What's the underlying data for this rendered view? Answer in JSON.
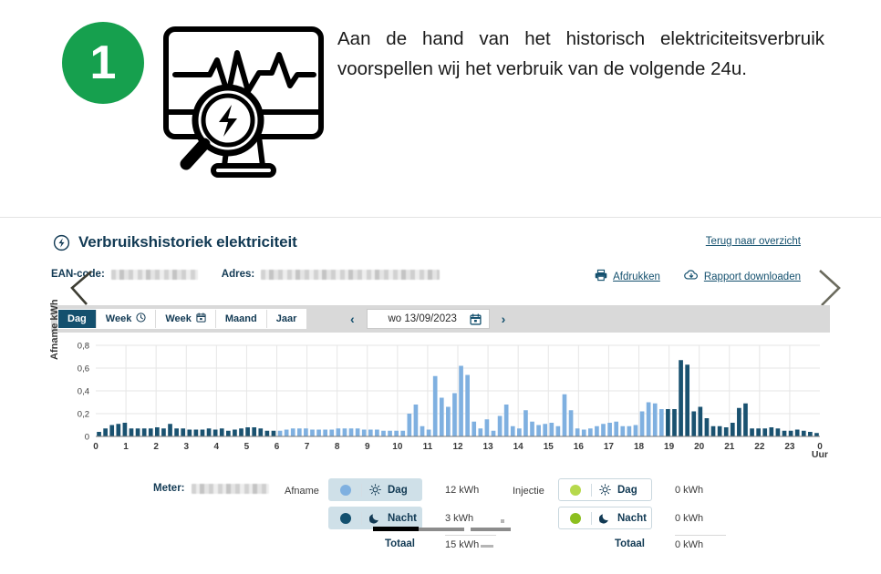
{
  "intro": {
    "step_number": "1",
    "text": "Aan de hand van het historisch elektriciteitsverbruik voorspellen wij het verbruik van de volgende 24u.",
    "badge_color": "#16a04e",
    "illustration_icon": "monitor-ecg-magnifier-bolt-icon"
  },
  "panel": {
    "title": "Verbruikshistoriek elektriciteit",
    "title_icon": "lightning-circle-icon",
    "back_link": "Terug naar overzicht",
    "meta": {
      "ean_label": "EAN-code:",
      "ean_value": "",
      "address_label": "Adres:",
      "address_value": ""
    },
    "actions": [
      {
        "label": "Afdrukken",
        "icon": "printer-icon"
      },
      {
        "label": "Rapport downloaden",
        "icon": "cloud-download-icon"
      }
    ]
  },
  "toolbar": {
    "tabs": [
      {
        "label": "Dag",
        "icon": "",
        "active": true
      },
      {
        "label": "Week",
        "icon": "clock-icon",
        "active": false
      },
      {
        "label": "Week",
        "icon": "calendar-icon",
        "active": false
      },
      {
        "label": "Maand",
        "icon": "",
        "active": false
      },
      {
        "label": "Jaar",
        "icon": "",
        "active": false
      }
    ],
    "prev_arrow": "‹",
    "next_arrow": "›",
    "date_value": "wo 13/09/2023",
    "date_icon": "calendar-icon"
  },
  "chart_data": {
    "type": "bar",
    "title": "",
    "xlabel": "Uur",
    "ylabel": "Afname kWh",
    "ylim": [
      0,
      0.8
    ],
    "yticks": [
      "0",
      "0,2",
      "0,4",
      "0,6",
      "0,8"
    ],
    "ytick_values": [
      0,
      0.2,
      0.4,
      0.6,
      0.8
    ],
    "xticks": [
      "0",
      "1",
      "2",
      "3",
      "4",
      "5",
      "6",
      "7",
      "8",
      "9",
      "10",
      "11",
      "12",
      "13",
      "14",
      "15",
      "16",
      "17",
      "18",
      "19",
      "20",
      "21",
      "22",
      "23",
      "0"
    ],
    "grid": true,
    "legend_position": "below",
    "interval_hours": 0.25,
    "series": [
      {
        "name": "Nacht",
        "color": "#1a5270",
        "note": "Dark navy bars: 00:00–07:00 and 22:00–24:00"
      },
      {
        "name": "Dag",
        "color": "#7fb0e0",
        "note": "Light blue bars: 07:00–22:00"
      }
    ],
    "values": [
      0.04,
      0.07,
      0.1,
      0.11,
      0.12,
      0.07,
      0.07,
      0.07,
      0.07,
      0.08,
      0.07,
      0.11,
      0.07,
      0.07,
      0.06,
      0.06,
      0.06,
      0.07,
      0.06,
      0.07,
      0.05,
      0.06,
      0.07,
      0.08,
      0.08,
      0.07,
      0.05,
      0.05,
      0.05,
      0.06,
      0.07,
      0.07,
      0.07,
      0.06,
      0.06,
      0.06,
      0.06,
      0.07,
      0.07,
      0.07,
      0.07,
      0.06,
      0.06,
      0.06,
      0.05,
      0.05,
      0.05,
      0.05,
      0.2,
      0.28,
      0.09,
      0.06,
      0.53,
      0.34,
      0.26,
      0.38,
      0.62,
      0.54,
      0.13,
      0.07,
      0.15,
      0.05,
      0.18,
      0.28,
      0.09,
      0.07,
      0.23,
      0.13,
      0.1,
      0.11,
      0.12,
      0.09,
      0.37,
      0.23,
      0.07,
      0.06,
      0.07,
      0.09,
      0.11,
      0.12,
      0.13,
      0.09,
      0.09,
      0.1,
      0.22,
      0.3,
      0.29,
      0.24,
      0.24,
      0.24,
      0.67,
      0.63,
      0.22,
      0.26,
      0.16,
      0.09,
      0.09,
      0.08,
      0.12,
      0.25,
      0.29,
      0.07,
      0.07,
      0.07,
      0.08,
      0.07,
      0.05,
      0.05,
      0.06,
      0.05,
      0.04,
      0.03
    ]
  },
  "footer": {
    "meter_label": "Meter:",
    "meter_value": "",
    "afname_label": "Afname",
    "injectie_label": "Injectie",
    "afname": {
      "rows": [
        {
          "label": "Dag",
          "icon": "sun-icon",
          "dot_color": "#7fb0e0",
          "value": "12 kWh",
          "selected": true
        },
        {
          "label": "Nacht",
          "icon": "moon-icon",
          "dot_color": "#12506f",
          "value": "3 kWh",
          "selected": true
        }
      ],
      "total_label": "Totaal",
      "total_value": "15 kWh"
    },
    "injectie": {
      "rows": [
        {
          "label": "Dag",
          "icon": "sun-icon",
          "dot_color": "#b6d94c",
          "value": "0 kWh",
          "selected": false
        },
        {
          "label": "Nacht",
          "icon": "moon-icon",
          "dot_color": "#8cbf1f",
          "value": "0 kWh",
          "selected": false
        }
      ],
      "total_label": "Totaal",
      "total_value": "0 kWh"
    }
  }
}
